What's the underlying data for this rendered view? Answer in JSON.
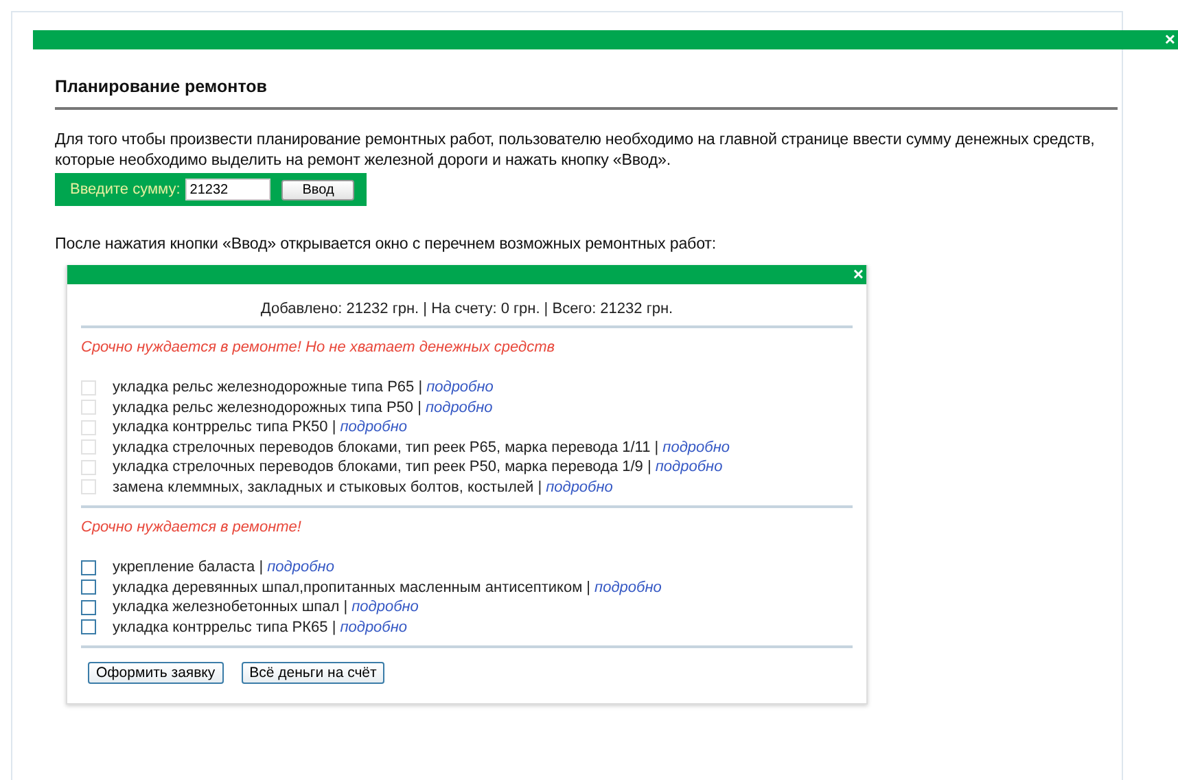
{
  "page": {
    "heading": "Планирование ремонтов",
    "intro": "Для того чтобы произвести планирование ремонтных работ, пользователю необходимо на главной странице ввести сумму денежных средств, которые необходимо выделить на ремонт железной дороги и нажать кнопку «Ввод».",
    "sum_form": {
      "label": "Введите сумму:",
      "value": "21232",
      "button": "Ввод"
    },
    "after_text": "После нажатия кнопки «Ввод» открывается окно с перечнем возможных ремонтных работ:",
    "close_icon": "×"
  },
  "dialog": {
    "close_icon": "×",
    "summary": "Добавлено: 21232 грн. | На счету: 0 грн. | Всего: 21232 грн.",
    "sections": [
      {
        "title": "Срочно нуждается в ремонте! Но не хватает денежных средств",
        "items": [
          {
            "label": "укладка рельс железнодорожные типа Р65 |",
            "link": "подробно",
            "checked": false,
            "disabled": true
          },
          {
            "label": "укладка рельс железнодорожных типа Р50 |",
            "link": "подробно",
            "checked": false,
            "disabled": true
          },
          {
            "label": "укладка контррельс типа РК50 |",
            "link": "подробно",
            "checked": false,
            "disabled": true
          },
          {
            "label": "укладка стрелочных переводов блоками, тип реек Р65, марка перевода 1/11 |",
            "link": "подробно",
            "checked": false,
            "disabled": true
          },
          {
            "label": "укладка стрелочных переводов блоками, тип реек Р50, марка перевода 1/9 |",
            "link": "подробно",
            "checked": false,
            "disabled": true
          },
          {
            "label": "замена клеммных, закладных и стыковых болтов, костылей |",
            "link": "подробно",
            "checked": false,
            "disabled": true
          }
        ]
      },
      {
        "title": "Срочно нуждается в ремонте!",
        "items": [
          {
            "label": "укрепление баласта |",
            "link": "подробно",
            "checked": false,
            "disabled": false
          },
          {
            "label": "укладка деревянных шпал,пропитанных масленным антисептиком |",
            "link": "подробно",
            "checked": false,
            "disabled": false
          },
          {
            "label": "укладка железнобетонных шпал |",
            "link": "подробно",
            "checked": false,
            "disabled": false
          },
          {
            "label": "укладка контррельс типа РК65 |",
            "link": "подробно",
            "checked": false,
            "disabled": false
          }
        ]
      }
    ],
    "buttons": [
      "Оформить заявку",
      "Всё деньги на счёт"
    ]
  }
}
